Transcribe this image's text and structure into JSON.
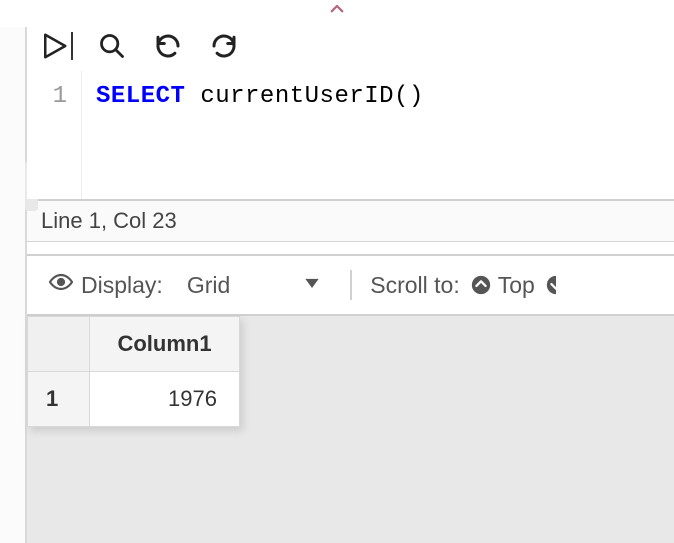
{
  "editor": {
    "line_number": "1",
    "code_keyword": "SELECT",
    "code_rest": " currentUserID()"
  },
  "status_bar": {
    "cursor": "Line 1, Col 23"
  },
  "results_toolbar": {
    "display_label": "Display:",
    "display_mode": "Grid",
    "scroll_label": "Scroll to:",
    "scroll_top_label": "Top"
  },
  "results_table": {
    "headers": [
      "Column1"
    ],
    "rows": [
      {
        "num": "1",
        "cells": [
          "1976"
        ]
      }
    ]
  }
}
